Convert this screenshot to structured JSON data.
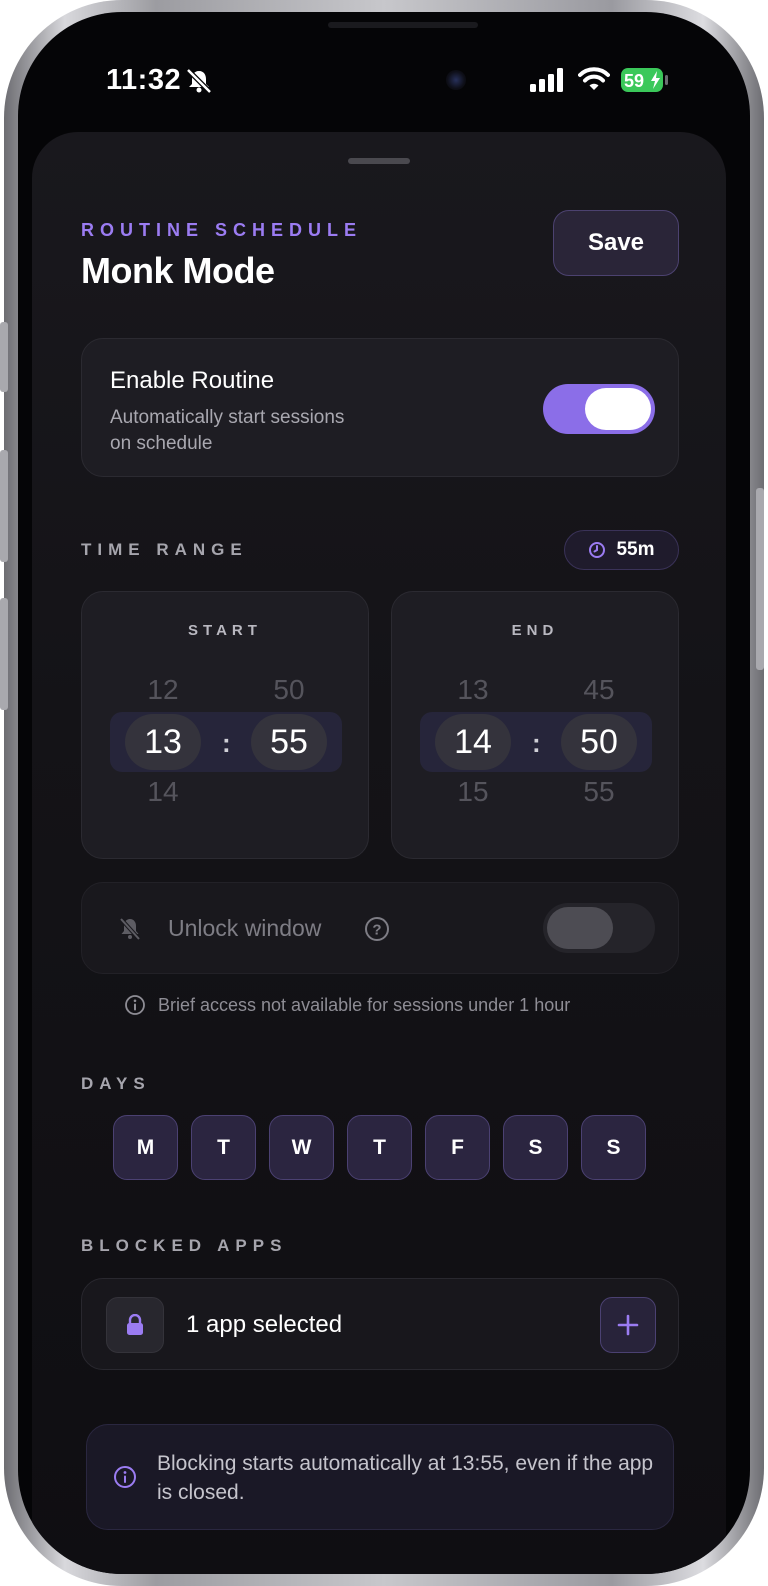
{
  "status_bar": {
    "time": "11:32",
    "battery": "59"
  },
  "header": {
    "eyebrow": "ROUTINE SCHEDULE",
    "title": "Monk Mode",
    "save_label": "Save"
  },
  "enable_routine": {
    "title": "Enable Routine",
    "subtitle": "Automatically start sessions on schedule",
    "enabled": true
  },
  "time_range": {
    "label": "TIME RANGE",
    "duration": "55m",
    "start": {
      "label": "START",
      "hour_prev": "12",
      "hour": "13",
      "hour_next": "14",
      "minute_prev": "50",
      "minute": "55"
    },
    "end": {
      "label": "END",
      "hour_prev": "13",
      "hour": "14",
      "hour_next": "15",
      "minute_prev": "45",
      "minute": "50",
      "minute_next": "55"
    },
    "separator": ":"
  },
  "unlock_window": {
    "label": "Unlock window",
    "help_icon": "?",
    "enabled": false,
    "note": "Brief access not available for sessions under 1 hour"
  },
  "days": {
    "label": "DAYS",
    "items": [
      "M",
      "T",
      "W",
      "T",
      "F",
      "S",
      "S"
    ]
  },
  "blocked_apps": {
    "label": "BLOCKED APPS",
    "summary": "1 app selected"
  },
  "info": {
    "text": "Blocking starts automatically at 13:55, even if the app is closed."
  },
  "colors": {
    "accent": "#8b6ee8",
    "eyebrow": "#9b7cf2",
    "background": "#0f0e12"
  },
  "icons": {
    "bell": "bell-slash-icon",
    "clock": "clock-icon",
    "lock": "lock-icon",
    "plus": "plus-icon",
    "info": "info-icon",
    "unlock_bell": "bell-slash-icon"
  }
}
